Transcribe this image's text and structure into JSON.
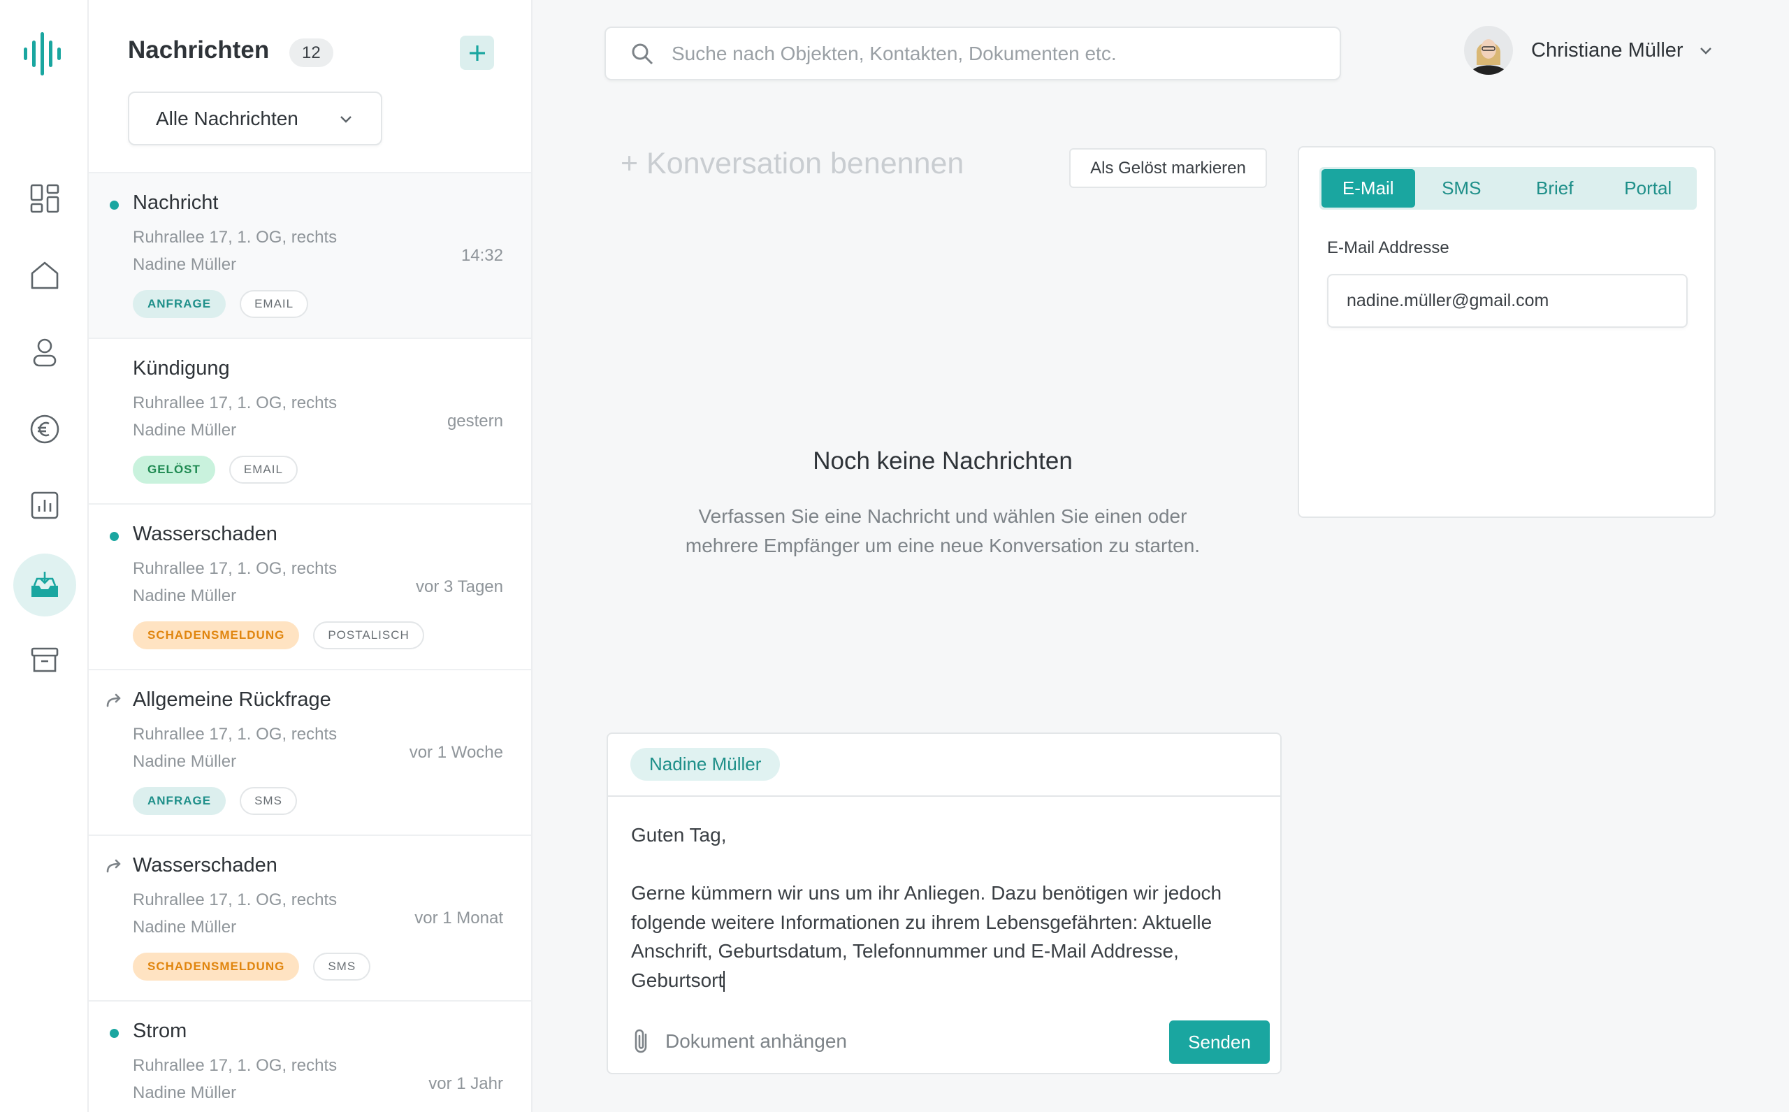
{
  "colors": {
    "accent": "#1aa6a0",
    "accent_light": "#dcefee",
    "tag_geloest": "#c9f2dd",
    "tag_schaden": "#ffe3c2"
  },
  "sidebar": {
    "logo": "waveform-logo",
    "items": [
      {
        "icon": "dashboard-icon",
        "active": false
      },
      {
        "icon": "home-icon",
        "active": false
      },
      {
        "icon": "person-icon",
        "active": false
      },
      {
        "icon": "euro-icon",
        "active": false
      },
      {
        "icon": "chart-icon",
        "active": false
      },
      {
        "icon": "inbox-icon",
        "active": true
      },
      {
        "icon": "archive-icon",
        "active": false
      }
    ]
  },
  "messages_panel": {
    "title": "Nachrichten",
    "count": "12",
    "filter": "Alle Nachrichten",
    "items": [
      {
        "title": "Nachricht",
        "address": "Ruhrallee 17, 1. OG, rechts",
        "name": "Nadine Müller",
        "time": "14:32",
        "tag": "ANFRAGE",
        "channel": "EMAIL",
        "marker": "dot"
      },
      {
        "title": "Kündigung",
        "address": "Ruhrallee 17, 1. OG, rechts",
        "name": "Nadine Müller",
        "time": "gestern",
        "tag": "GELÖST",
        "channel": "EMAIL",
        "marker": "none"
      },
      {
        "title": "Wasserschaden",
        "address": "Ruhrallee 17, 1. OG, rechts",
        "name": "Nadine Müller",
        "time": "vor 3 Tagen",
        "tag": "SCHADENSMELDUNG",
        "channel": "POSTALISCH",
        "marker": "dot"
      },
      {
        "title": "Allgemeine Rückfrage",
        "address": "Ruhrallee 17, 1. OG, rechts",
        "name": "Nadine Müller",
        "time": "vor 1 Woche",
        "tag": "ANFRAGE",
        "channel": "SMS",
        "marker": "forward"
      },
      {
        "title": "Wasserschaden",
        "address": "Ruhrallee 17, 1. OG, rechts",
        "name": "Nadine Müller",
        "time": "vor 1 Monat",
        "tag": "SCHADENSMELDUNG",
        "channel": "SMS",
        "marker": "forward"
      },
      {
        "title": "Strom",
        "address": "Ruhrallee 17, 1. OG, rechts",
        "name": "Nadine Müller",
        "time": "vor 1 Jahr",
        "marker": "dot"
      }
    ]
  },
  "topbar": {
    "search_placeholder": "Suche nach Objekten, Kontakten, Dokumenten etc.",
    "user_name": "Christiane Müller"
  },
  "conversation": {
    "name_placeholder": "+ Konversation benennen",
    "resolve_label": "Als Gelöst markieren",
    "empty_title": "Noch keine Nachrichten",
    "empty_text": "Verfassen Sie eine Nachricht und wählen Sie einen oder mehrere Empfänger um eine neue Konversation zu starten."
  },
  "composer": {
    "recipient": "Nadine Müller",
    "body": "Guten Tag,\n\nGerne kümmern wir uns um ihr Anliegen. Dazu benötigen wir jedoch folgende weitere Informationen zu ihrem Lebensgefährten: Aktuelle Anschrift, Geburtsdatum, Telefonnummer und E-Mail Addresse, Geburtsort",
    "attach_label": "Dokument anhängen",
    "send_label": "Senden"
  },
  "channel": {
    "tabs": [
      "E-Mail",
      "SMS",
      "Brief",
      "Portal"
    ],
    "active_tab": "E-Mail",
    "email_label": "E-Mail Addresse",
    "email_value": "nadine.müller@gmail.com"
  }
}
